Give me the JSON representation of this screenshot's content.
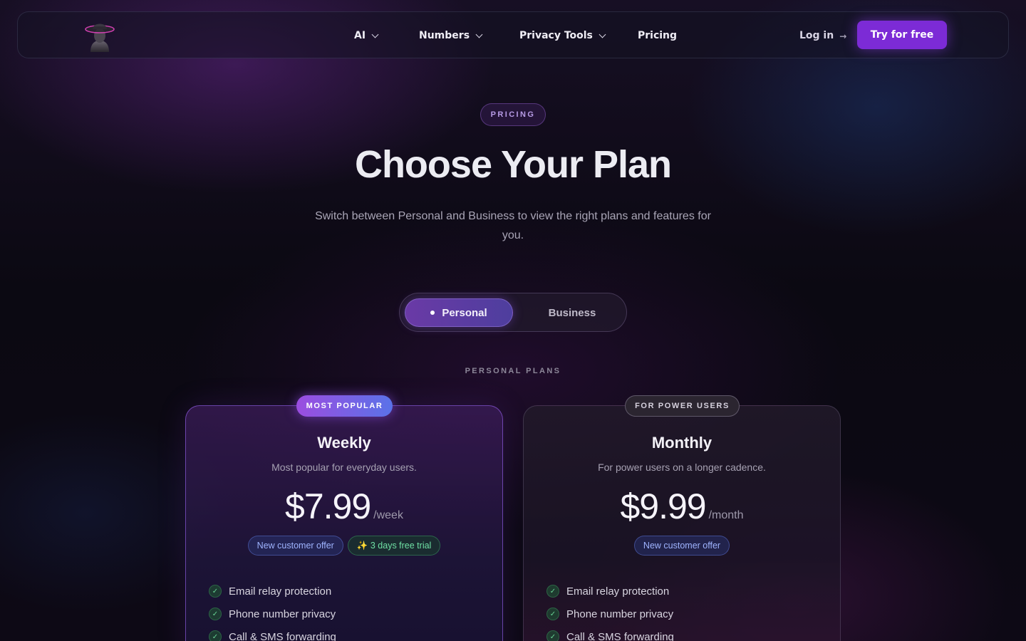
{
  "nav": {
    "logo_icon": "hat-avatar-logo",
    "items": [
      {
        "label": "AI",
        "dropdown": true
      },
      {
        "label": "Numbers",
        "dropdown": true
      },
      {
        "label": "Privacy Tools",
        "dropdown": true
      },
      {
        "label": "Pricing",
        "dropdown": false
      }
    ],
    "login_label": "Log in",
    "login_arrow": "→",
    "cta_label": "Try for free"
  },
  "hero": {
    "tag": "PRICING",
    "title": "Choose Your Plan",
    "subtitle": "Switch between Personal and Business to view the right plans and features for you."
  },
  "toggle": {
    "options": [
      "Personal",
      "Business"
    ],
    "selected": "Personal"
  },
  "section_label": "PERSONAL PLANS",
  "plans": [
    {
      "badge": "MOST POPULAR",
      "name": "Weekly",
      "description": "Most popular for everyday users.",
      "price": "$7.99",
      "period": "/week",
      "chips": [
        "New customer offer",
        "✨ 3 days free trial"
      ],
      "features": [
        "Email relay protection",
        "Phone number privacy",
        "Call & SMS forwarding"
      ]
    },
    {
      "badge": "FOR POWER USERS",
      "name": "Monthly",
      "description": "For power users on a longer cadence.",
      "price": "$9.99",
      "period": "/month",
      "chips": [
        "New customer offer"
      ],
      "features": [
        "Email relay protection",
        "Phone number privacy",
        "Call & SMS forwarding"
      ]
    }
  ],
  "colors": {
    "accent": "#7c2bd6",
    "background": "#0a0812",
    "offer_chip": "#9fb4ff",
    "trial_chip": "#6fe0a4"
  }
}
